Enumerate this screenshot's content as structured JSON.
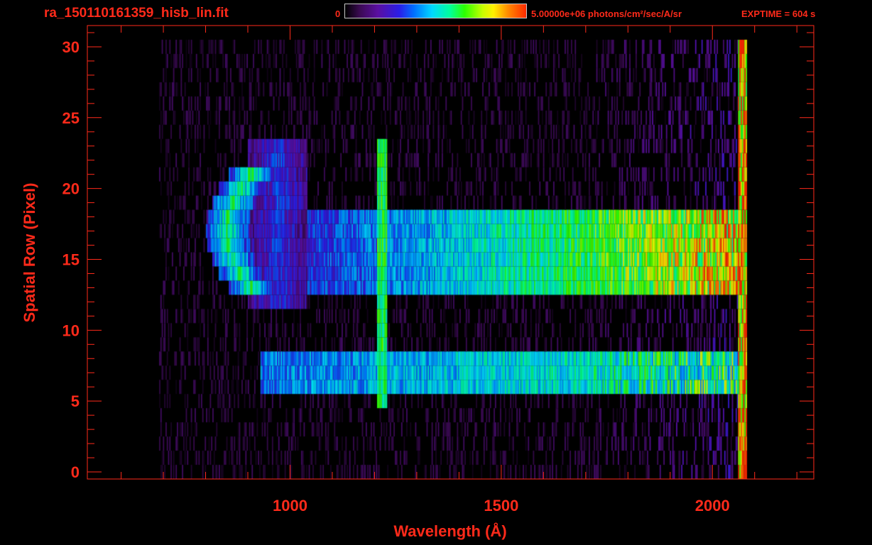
{
  "header": {
    "filename": "ra_150110161359_hisb_lin.fit",
    "colorbar_min_label": "0",
    "colorbar_max_label": "5.00000e+06 photons/cm²/sec/A/sr",
    "exptime_label": "EXPTIME = 604 s"
  },
  "colors": {
    "text": "#ff2a1a",
    "axis": "#ff2a1a",
    "background": "#000000"
  },
  "chart_data": {
    "type": "heatmap",
    "xlabel": "Wavelength (Å)",
    "ylabel": "Spatial Row (Pixel)",
    "xlim": [
      520,
      2240
    ],
    "ylim": [
      -0.5,
      31.5
    ],
    "x_ticks": [
      1000,
      1500,
      2000
    ],
    "y_ticks": [
      0,
      5,
      10,
      15,
      20,
      25,
      30
    ],
    "x_minor_step": 100,
    "y_minor_step": 1,
    "colorbar": {
      "min": 0,
      "max": 5000000,
      "units": "photons/cm²/sec/A/sr",
      "colormap": "rainbow"
    },
    "grid": false,
    "coverage": {
      "x_range": [
        690,
        2080
      ],
      "rows": [
        0,
        30
      ]
    },
    "features": [
      {
        "feature": "bright arc",
        "x_range": [
          800,
          900
        ],
        "rows": [
          13,
          21
        ],
        "peak_intensity": 0.58
      },
      {
        "feature": "faint arc",
        "x_range": [
          900,
          1040
        ],
        "rows": [
          12,
          23
        ],
        "peak_intensity": 0.3
      },
      {
        "feature": "emission line",
        "x_center": 1216,
        "rows": [
          5,
          23
        ],
        "peak_intensity": 0.6
      },
      {
        "feature": "continuum band",
        "x_range": [
          1040,
          2070
        ],
        "rows": [
          13,
          18
        ],
        "intensity_start": 0.3,
        "intensity_end": 0.8
      },
      {
        "feature": "continuum band",
        "x_range": [
          930,
          2060
        ],
        "rows": [
          6,
          8
        ],
        "intensity_start": 0.38,
        "intensity_end": 0.58
      },
      {
        "feature": "edge spike",
        "x_center": 2070,
        "rows": [
          0,
          30
        ],
        "peak_intensity": 0.85
      }
    ]
  }
}
